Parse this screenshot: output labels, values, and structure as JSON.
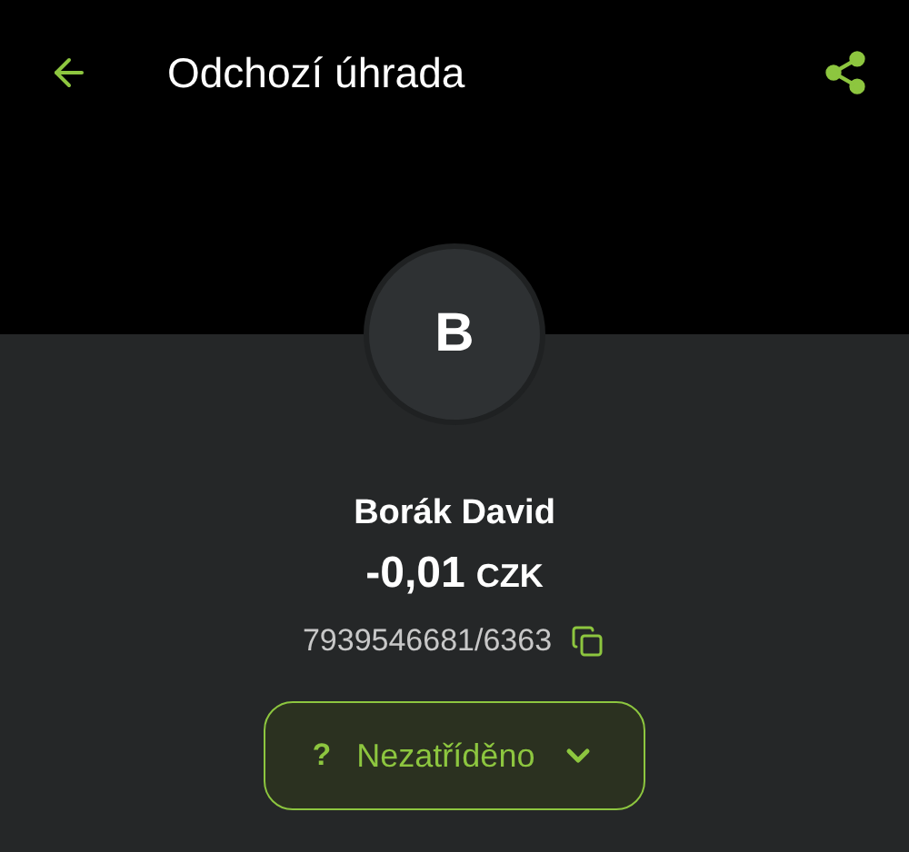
{
  "top_bar": {
    "title": "Odchozí úhrada"
  },
  "counterparty": {
    "initial": "B",
    "name": "Borák David",
    "amount": "-0,01",
    "currency": "CZK",
    "account": "7939546681/6363"
  },
  "category": {
    "icon": "?",
    "label": "Nezatříděno"
  }
}
